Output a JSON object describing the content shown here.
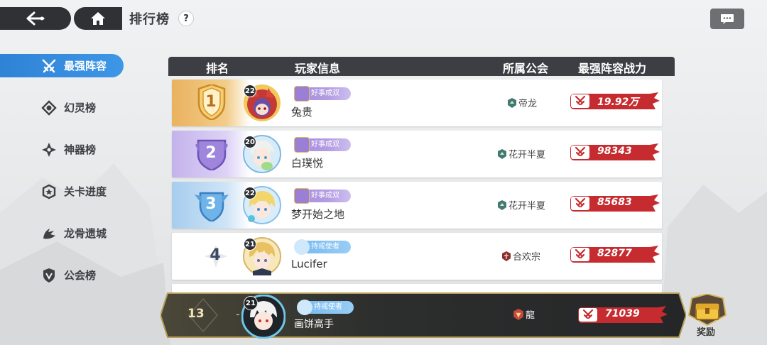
{
  "header": {
    "title": "排行榜",
    "help": "?"
  },
  "sidebar": {
    "items": [
      {
        "label": "最强阵容",
        "icon": "crossed-swords-icon",
        "active": true
      },
      {
        "label": "幻灵榜",
        "icon": "spirit-icon",
        "active": false
      },
      {
        "label": "神器榜",
        "icon": "artifact-icon",
        "active": false
      },
      {
        "label": "关卡进度",
        "icon": "stage-icon",
        "active": false
      },
      {
        "label": "龙骨遗城",
        "icon": "dragon-icon",
        "active": false
      },
      {
        "label": "公会榜",
        "icon": "guild-shield-icon",
        "active": false
      }
    ]
  },
  "table": {
    "columns": [
      "排名",
      "玩家信息",
      "所属公会",
      "最强阵容战力"
    ],
    "rows": [
      {
        "rank": "1",
        "level": "22",
        "title": "好事成双",
        "name": "兔贵",
        "guild": "帝龙",
        "power": "19.92万"
      },
      {
        "rank": "2",
        "level": "20",
        "title": "好事成双",
        "name": "白璞悦",
        "guild": "花开半夏",
        "power": "98343"
      },
      {
        "rank": "3",
        "level": "22",
        "title": "好事成双",
        "name": "梦开始之地",
        "guild": "花开半夏",
        "power": "85683"
      },
      {
        "rank": "4",
        "level": "21",
        "title": "持戒使者",
        "name": "Lucifer",
        "guild": "合欢宗",
        "power": "82877"
      }
    ]
  },
  "my_rank": {
    "rank": "13",
    "dash": "-",
    "level": "21",
    "title": "持戒使者",
    "name": "画饼高手",
    "guild": "龍",
    "power": "71039"
  },
  "reward": {
    "label": "奖励"
  },
  "colors": {
    "accent": "#3a8fe0",
    "gold": "#e8b25b",
    "purple": "#b49de3",
    "blue": "#8fc3ee",
    "power_red": "#c9232b"
  }
}
